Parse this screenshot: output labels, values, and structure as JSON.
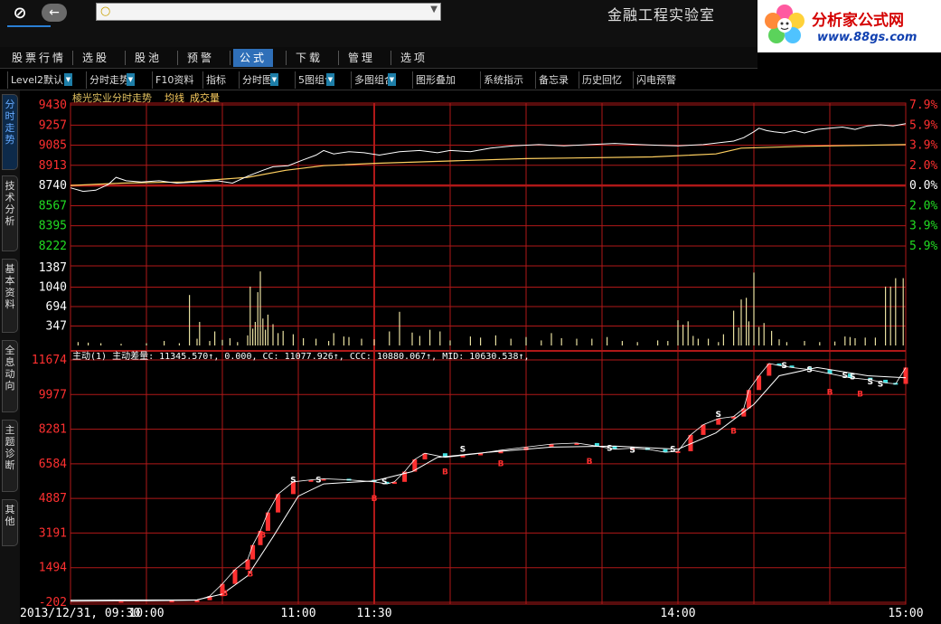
{
  "app": {
    "lab_title": "金融工程实验室",
    "brand_name": "分析家公式网",
    "brand_url": "www.88gs.com",
    "search": {
      "placeholder": ""
    }
  },
  "colors": {
    "up": "#ff3030",
    "down": "#22dd22",
    "grid": "#b01818",
    "price": "#ffffff",
    "avg": "#ffd060",
    "cyan": "#40e0e0",
    "magenta": "#ff40ff"
  },
  "menu": [
    {
      "label": "股票行情",
      "active": false
    },
    {
      "label": "选股",
      "active": false
    },
    {
      "label": "股池",
      "active": false
    },
    {
      "label": "预警",
      "active": false
    },
    {
      "label": "公式",
      "active": true
    },
    {
      "label": "下载",
      "active": false
    },
    {
      "label": "管理",
      "active": false
    },
    {
      "label": "选项",
      "active": false
    }
  ],
  "toolbar": [
    {
      "label": "Level2默认",
      "dropdown": true
    },
    {
      "label": "分时走势",
      "dropdown": true
    },
    {
      "label": "F10资料",
      "dropdown": false
    },
    {
      "label": "指标",
      "dropdown": false
    },
    {
      "label": "分时图",
      "dropdown": true
    },
    {
      "label": "5图组合",
      "dropdown": true
    },
    {
      "label": "多图组合",
      "dropdown": true
    },
    {
      "label": "图形叠加",
      "dropdown": false
    },
    {
      "label": "系统指示",
      "dropdown": false
    },
    {
      "label": "备忘录",
      "dropdown": false
    },
    {
      "label": "历史回忆",
      "dropdown": false
    },
    {
      "label": "闪电预警",
      "dropdown": false
    }
  ],
  "side_tabs": [
    {
      "label": "分时走势",
      "active": true
    },
    {
      "label": "技术分析",
      "active": false
    },
    {
      "label": "基本资料",
      "active": false
    },
    {
      "label": "全息动向",
      "active": false
    },
    {
      "label": "主题诊断",
      "active": false
    },
    {
      "label": "其他",
      "active": false
    }
  ],
  "chart_data": {
    "type": "line",
    "title": "棱光实业分时走势",
    "legend": [
      "均线",
      "成交量"
    ],
    "price_panel": {
      "y_labels_left": [
        "9430",
        "9257",
        "9085",
        "8913",
        "8740",
        "8567",
        "8395",
        "8222"
      ],
      "y_labels_right": [
        "7.9%",
        "5.9%",
        "3.9%",
        "2.0%",
        "0.0%",
        "2.0%",
        "3.9%",
        "5.9%"
      ],
      "base": 8740,
      "price_series": [
        [
          0,
          8720
        ],
        [
          5,
          8690
        ],
        [
          10,
          8700
        ],
        [
          15,
          8750
        ],
        [
          18,
          8810
        ],
        [
          22,
          8780
        ],
        [
          28,
          8770
        ],
        [
          35,
          8780
        ],
        [
          42,
          8760
        ],
        [
          50,
          8770
        ],
        [
          58,
          8780
        ],
        [
          64,
          8760
        ],
        [
          70,
          8820
        ],
        [
          76,
          8870
        ],
        [
          80,
          8900
        ],
        [
          86,
          8910
        ],
        [
          92,
          8960
        ],
        [
          97,
          9000
        ],
        [
          100,
          9040
        ],
        [
          104,
          9010
        ],
        [
          110,
          9030
        ],
        [
          116,
          9020
        ],
        [
          122,
          9000
        ],
        [
          130,
          9030
        ],
        [
          138,
          9040
        ],
        [
          145,
          9020
        ],
        [
          150,
          9040
        ],
        [
          158,
          9030
        ],
        [
          166,
          9060
        ],
        [
          175,
          9080
        ],
        [
          185,
          9090
        ],
        [
          195,
          9080
        ],
        [
          205,
          9090
        ],
        [
          215,
          9100
        ],
        [
          225,
          9090
        ],
        [
          232,
          9085
        ],
        [
          240,
          9080
        ],
        [
          250,
          9090
        ],
        [
          258,
          9110
        ],
        [
          262,
          9120
        ],
        [
          266,
          9150
        ],
        [
          270,
          9200
        ],
        [
          272,
          9230
        ],
        [
          275,
          9210
        ],
        [
          278,
          9200
        ],
        [
          282,
          9190
        ],
        [
          286,
          9210
        ],
        [
          290,
          9190
        ],
        [
          295,
          9220
        ],
        [
          300,
          9230
        ],
        [
          305,
          9240
        ],
        [
          310,
          9220
        ],
        [
          315,
          9250
        ],
        [
          320,
          9260
        ],
        [
          325,
          9250
        ],
        [
          330,
          9270
        ]
      ],
      "avg_series": [
        [
          0,
          8740
        ],
        [
          20,
          8760
        ],
        [
          45,
          8770
        ],
        [
          70,
          8810
        ],
        [
          85,
          8870
        ],
        [
          100,
          8910
        ],
        [
          120,
          8930
        ],
        [
          150,
          8950
        ],
        [
          180,
          8970
        ],
        [
          230,
          8985
        ],
        [
          255,
          9010
        ],
        [
          265,
          9060
        ],
        [
          290,
          9075
        ],
        [
          330,
          9090
        ]
      ]
    },
    "volume_panel": {
      "y_labels": [
        "1387",
        "1040",
        "694",
        "347"
      ],
      "bars": [
        [
          3,
          60
        ],
        [
          7,
          50
        ],
        [
          12,
          40
        ],
        [
          20,
          30
        ],
        [
          30,
          40
        ],
        [
          37,
          80
        ],
        [
          43,
          40
        ],
        [
          47,
          900
        ],
        [
          50,
          120
        ],
        [
          51,
          420
        ],
        [
          55,
          80
        ],
        [
          57,
          250
        ],
        [
          60,
          100
        ],
        [
          63,
          130
        ],
        [
          66,
          60
        ],
        [
          70,
          180
        ],
        [
          71,
          1050
        ],
        [
          72,
          300
        ],
        [
          73,
          420
        ],
        [
          74,
          950
        ],
        [
          75,
          1320
        ],
        [
          76,
          480
        ],
        [
          77,
          280
        ],
        [
          78,
          550
        ],
        [
          80,
          380
        ],
        [
          82,
          220
        ],
        [
          84,
          260
        ],
        [
          88,
          200
        ],
        [
          92,
          130
        ],
        [
          97,
          120
        ],
        [
          102,
          80
        ],
        [
          104,
          220
        ],
        [
          108,
          160
        ],
        [
          110,
          150
        ],
        [
          115,
          120
        ],
        [
          120,
          110
        ],
        [
          126,
          250
        ],
        [
          130,
          600
        ],
        [
          135,
          230
        ],
        [
          138,
          170
        ],
        [
          142,
          280
        ],
        [
          146,
          250
        ],
        [
          150,
          90
        ],
        [
          158,
          160
        ],
        [
          162,
          140
        ],
        [
          168,
          180
        ],
        [
          174,
          120
        ],
        [
          180,
          150
        ],
        [
          186,
          90
        ],
        [
          190,
          220
        ],
        [
          194,
          130
        ],
        [
          200,
          120
        ],
        [
          206,
          120
        ],
        [
          212,
          150
        ],
        [
          218,
          80
        ],
        [
          224,
          60
        ],
        [
          232,
          90
        ],
        [
          236,
          80
        ],
        [
          240,
          450
        ],
        [
          242,
          370
        ],
        [
          244,
          430
        ],
        [
          246,
          170
        ],
        [
          248,
          120
        ],
        [
          252,
          120
        ],
        [
          256,
          60
        ],
        [
          258,
          200
        ],
        [
          262,
          620
        ],
        [
          264,
          320
        ],
        [
          265,
          820
        ],
        [
          267,
          850
        ],
        [
          268,
          430
        ],
        [
          270,
          1300
        ],
        [
          272,
          330
        ],
        [
          274,
          400
        ],
        [
          277,
          260
        ],
        [
          280,
          110
        ],
        [
          283,
          60
        ],
        [
          290,
          80
        ],
        [
          296,
          60
        ],
        [
          302,
          70
        ],
        [
          306,
          160
        ],
        [
          308,
          150
        ],
        [
          310,
          130
        ],
        [
          314,
          140
        ],
        [
          318,
          140
        ],
        [
          322,
          1050
        ],
        [
          324,
          1050
        ],
        [
          326,
          1200
        ],
        [
          329,
          1200
        ]
      ]
    },
    "indicator_panel": {
      "legend": "主动(1) 主动差量: 11345.570↑, 0.000, CC: 11077.926↑, CCC: 10880.067↑, MID: 10630.538↑,",
      "y_labels": [
        "11674",
        "9977",
        "8281",
        "6584",
        "4887",
        "3191",
        "1494",
        "-202"
      ],
      "x_labels": [
        "2013/12/31, 09:30",
        "10:00",
        "11:00",
        "11:30",
        "14:00",
        "15:00"
      ],
      "series": [
        [
          0,
          -150
        ],
        [
          20,
          -140
        ],
        [
          40,
          -120
        ],
        [
          50,
          -100
        ],
        [
          55,
          100
        ],
        [
          60,
          700
        ],
        [
          65,
          1400
        ],
        [
          70,
          1900
        ],
        [
          72,
          2600
        ],
        [
          75,
          3300
        ],
        [
          78,
          4200
        ],
        [
          82,
          5100
        ],
        [
          88,
          5700
        ],
        [
          95,
          5800
        ],
        [
          100,
          5850
        ],
        [
          110,
          5800
        ],
        [
          120,
          5700
        ],
        [
          125,
          5600
        ],
        [
          128,
          5700
        ],
        [
          132,
          6200
        ],
        [
          136,
          6800
        ],
        [
          140,
          7100
        ],
        [
          148,
          6900
        ],
        [
          155,
          7000
        ],
        [
          162,
          7100
        ],
        [
          170,
          7250
        ],
        [
          180,
          7400
        ],
        [
          190,
          7550
        ],
        [
          200,
          7600
        ],
        [
          208,
          7450
        ],
        [
          215,
          7300
        ],
        [
          222,
          7350
        ],
        [
          228,
          7300
        ],
        [
          235,
          7150
        ],
        [
          240,
          7200
        ],
        [
          245,
          8000
        ],
        [
          250,
          8500
        ],
        [
          256,
          8800
        ],
        [
          262,
          8900
        ],
        [
          266,
          9300
        ],
        [
          268,
          10200
        ],
        [
          272,
          10900
        ],
        [
          276,
          11500
        ],
        [
          280,
          11400
        ],
        [
          285,
          11300
        ],
        [
          292,
          11200
        ],
        [
          300,
          11000
        ],
        [
          308,
          10800
        ],
        [
          316,
          10700
        ],
        [
          322,
          10550
        ],
        [
          326,
          10500
        ],
        [
          330,
          11300
        ]
      ],
      "smooth_series": [
        [
          0,
          -100
        ],
        [
          50,
          -80
        ],
        [
          60,
          200
        ],
        [
          70,
          1100
        ],
        [
          80,
          3000
        ],
        [
          90,
          5000
        ],
        [
          100,
          5600
        ],
        [
          120,
          5750
        ],
        [
          135,
          6200
        ],
        [
          145,
          6900
        ],
        [
          165,
          7150
        ],
        [
          190,
          7400
        ],
        [
          215,
          7450
        ],
        [
          240,
          7300
        ],
        [
          255,
          8100
        ],
        [
          270,
          9500
        ],
        [
          280,
          10900
        ],
        [
          295,
          11300
        ],
        [
          315,
          10900
        ],
        [
          330,
          10800
        ]
      ],
      "markers": [
        {
          "t": 61,
          "v": 650,
          "k": "B"
        },
        {
          "t": 71,
          "v": 1600,
          "k": "B"
        },
        {
          "t": 76,
          "v": 3500,
          "k": "B"
        },
        {
          "t": 88,
          "v": 5500,
          "k": "S"
        },
        {
          "t": 98,
          "v": 5500,
          "k": "S"
        },
        {
          "t": 120,
          "v": 5300,
          "k": "B"
        },
        {
          "t": 124,
          "v": 5400,
          "k": "S"
        },
        {
          "t": 148,
          "v": 6600,
          "k": "B"
        },
        {
          "t": 155,
          "v": 7000,
          "k": "S"
        },
        {
          "t": 170,
          "v": 7000,
          "k": "B"
        },
        {
          "t": 205,
          "v": 7100,
          "k": "B"
        },
        {
          "t": 213,
          "v": 7050,
          "k": "S"
        },
        {
          "t": 222,
          "v": 6950,
          "k": "S"
        },
        {
          "t": 238,
          "v": 7000,
          "k": "S"
        },
        {
          "t": 256,
          "v": 8700,
          "k": "S"
        },
        {
          "t": 262,
          "v": 8600,
          "k": "B"
        },
        {
          "t": 282,
          "v": 11100,
          "k": "S"
        },
        {
          "t": 292,
          "v": 10900,
          "k": "S"
        },
        {
          "t": 300,
          "v": 10500,
          "k": "B"
        },
        {
          "t": 306,
          "v": 10600,
          "k": "S"
        },
        {
          "t": 309,
          "v": 10550,
          "k": "S"
        },
        {
          "t": 312,
          "v": 10400,
          "k": "B"
        },
        {
          "t": 316,
          "v": 10300,
          "k": "S"
        },
        {
          "t": 320,
          "v": 10200,
          "k": "S"
        }
      ]
    }
  }
}
